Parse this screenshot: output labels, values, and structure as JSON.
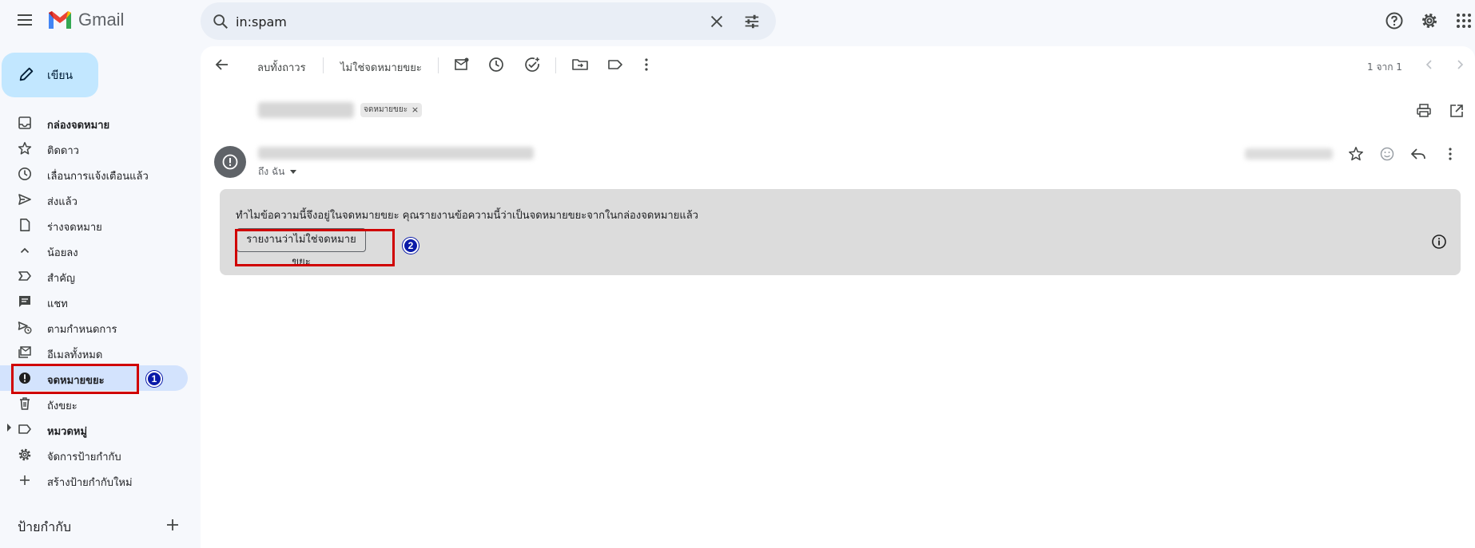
{
  "app": {
    "name": "Gmail"
  },
  "search": {
    "value": "in:spam"
  },
  "compose": {
    "label": "เขียน"
  },
  "nav": {
    "items": [
      {
        "label": "กล่องจดหมาย",
        "icon": "inbox-icon"
      },
      {
        "label": "ติดดาว",
        "icon": "star-icon"
      },
      {
        "label": "เลื่อนการแจ้งเตือนแล้ว",
        "icon": "clock-icon"
      },
      {
        "label": "ส่งแล้ว",
        "icon": "send-icon"
      },
      {
        "label": "ร่างจดหมาย",
        "icon": "draft-icon"
      },
      {
        "label": "น้อยลง",
        "icon": "chevron-up-icon"
      },
      {
        "label": "สำคัญ",
        "icon": "important-icon"
      },
      {
        "label": "แชท",
        "icon": "chat-icon"
      },
      {
        "label": "ตามกำหนดการ",
        "icon": "scheduled-icon"
      },
      {
        "label": "อีเมลทั้งหมด",
        "icon": "all-mail-icon"
      },
      {
        "label": "จดหมายขยะ",
        "icon": "spam-icon"
      },
      {
        "label": "ถังขยะ",
        "icon": "trash-icon"
      },
      {
        "label": "หมวดหมู่",
        "icon": "label-icon"
      },
      {
        "label": "จัดการป้ายกำกับ",
        "icon": "gear-icon"
      },
      {
        "label": "สร้างป้ายกำกับใหม่",
        "icon": "plus-icon"
      }
    ],
    "labels_heading": "ป้ายกำกับ"
  },
  "toolbar": {
    "delete_forever": "ลบทั้งถาวร",
    "not_spam": "ไม่ใช่จดหมายขยะ",
    "pager": "1 จาก 1"
  },
  "message": {
    "label_chip": "จดหมายขยะ",
    "to_line": "ถึง ฉัน",
    "spam_reason": "ทำไมข้อความนี้จึงอยู่ในจดหมายขยะ คุณรายงานข้อความนี้ว่าเป็นจดหมายขยะจากในกล่องจดหมายแล้ว",
    "report_button": "รายงานว่าไม่ใช่จดหมายขยะ"
  },
  "annotations": {
    "step1": "1",
    "step2": "2"
  },
  "colors": {
    "accent": "#c2e7ff",
    "active_nav": "#d3e3fd",
    "annotation_box": "#d00000",
    "annotation_badge": "#0a1aa8"
  }
}
